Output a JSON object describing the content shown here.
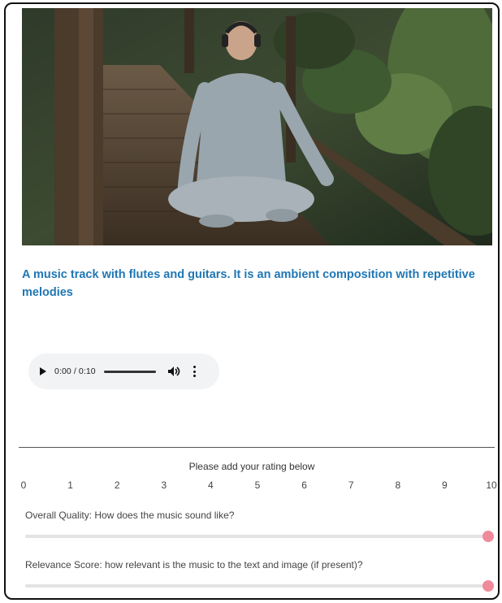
{
  "prompt": {
    "text": "A music track with flutes and guitars. It is an ambient composition with repetitive melodies"
  },
  "audio_player": {
    "time": "0:00 / 0:10",
    "icons": {
      "play": "play-icon",
      "volume": "volume-icon",
      "more": "more-options-icon"
    }
  },
  "rating": {
    "caption": "Please add your rating below",
    "scale": [
      "0",
      "1",
      "2",
      "3",
      "4",
      "5",
      "6",
      "7",
      "8",
      "9",
      "10"
    ],
    "questions": [
      {
        "label": "Overall Quality: How does the music sound like?",
        "value": 10,
        "min": 0,
        "max": 10
      },
      {
        "label": "Relevance Score: how relevant is the music to the text and image (if present)?",
        "value": 10,
        "min": 0,
        "max": 10
      }
    ],
    "accent_color": "#ef8a9a"
  },
  "colors": {
    "prompt_text": "#1f77b4",
    "player_bg": "#f1f3f4"
  }
}
